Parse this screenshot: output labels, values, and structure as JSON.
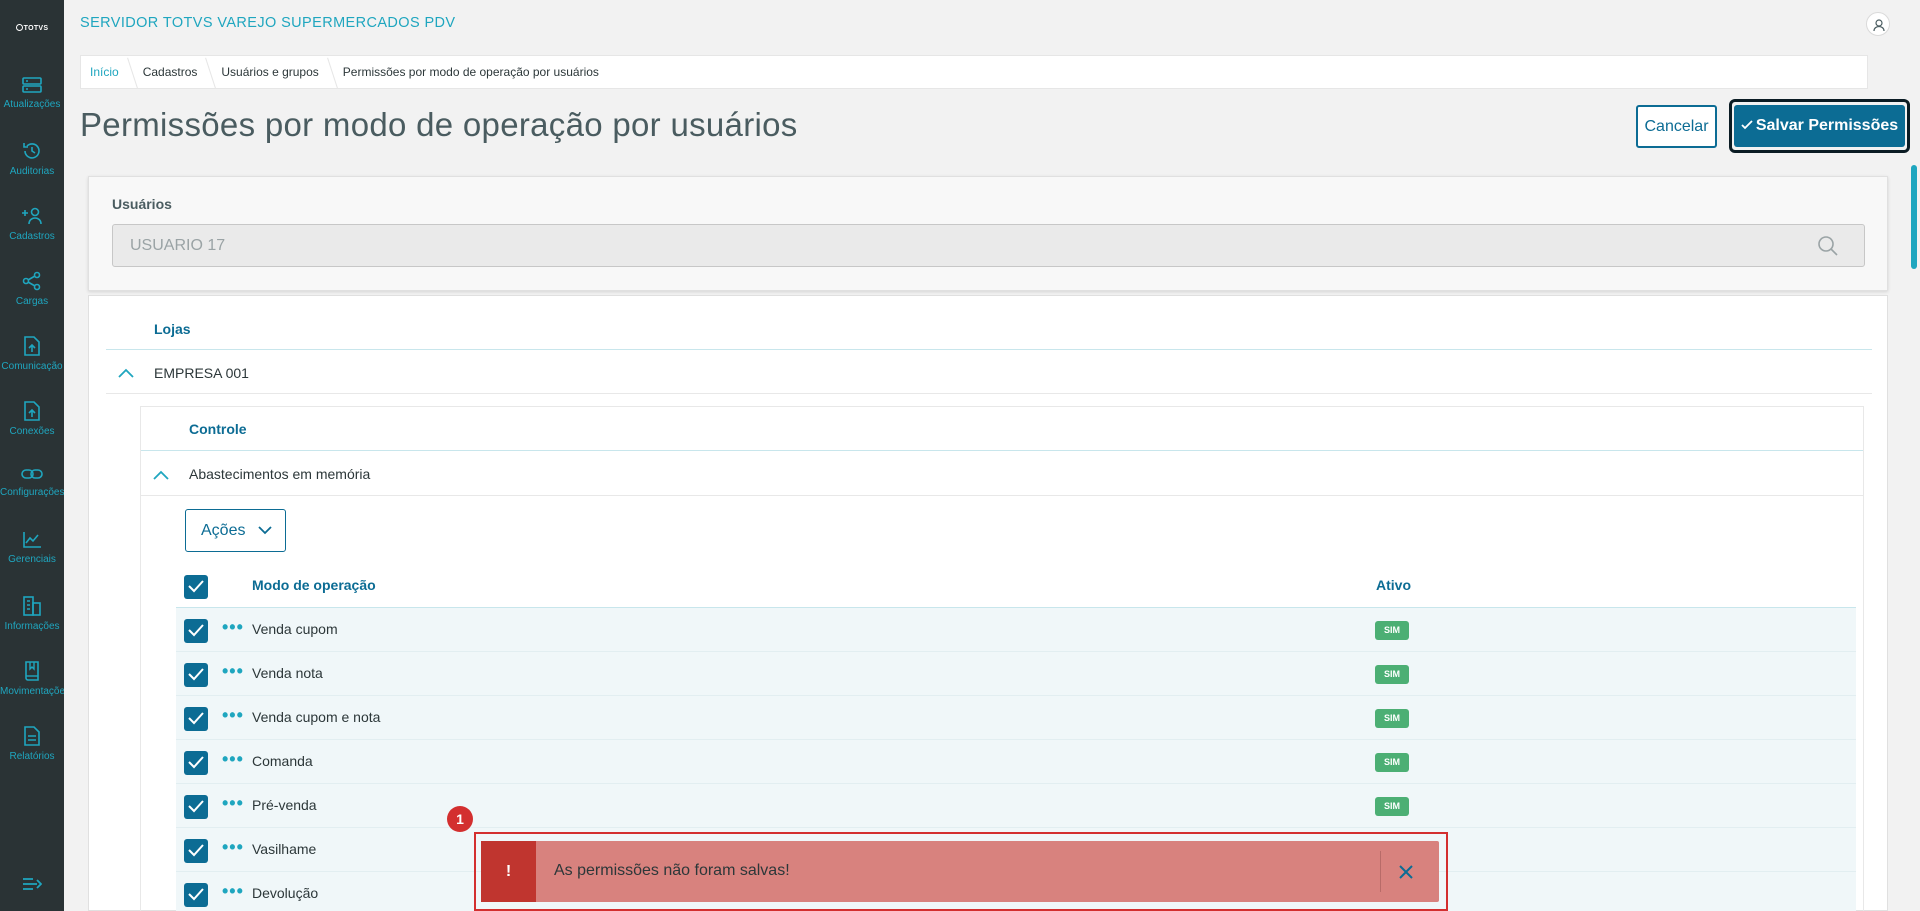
{
  "sidebar": {
    "logo_text": "TOTVS",
    "items": [
      {
        "label": "Atualizações",
        "icon": "server-icon"
      },
      {
        "label": "Auditorias",
        "icon": "history-icon"
      },
      {
        "label": "Cadastros",
        "icon": "add-user-icon"
      },
      {
        "label": "Cargas",
        "icon": "share-icon"
      },
      {
        "label": "Comunicação",
        "icon": "upload-file-icon"
      },
      {
        "label": "Conexões",
        "icon": "upload-file-icon"
      },
      {
        "label": "Configurações",
        "icon": "link-icon"
      },
      {
        "label": "Gerenciais",
        "icon": "chart-icon"
      },
      {
        "label": "Informações",
        "icon": "building-icon"
      },
      {
        "label": "Movimentações",
        "icon": "book-icon"
      },
      {
        "label": "Relatórios",
        "icon": "document-icon"
      }
    ]
  },
  "header": {
    "app_title": "SERVIDOR TOTVS VAREJO SUPERMERCADOS PDV"
  },
  "breadcrumb": [
    "Início",
    "Cadastros",
    "Usuários e grupos",
    "Permissões por modo de operação por usuários"
  ],
  "page": {
    "title": "Permissões por modo de operação por usuários",
    "cancel_label": "Cancelar",
    "save_label": "Salvar Permissões"
  },
  "users": {
    "label": "Usuários",
    "value": "USUARIO 17"
  },
  "stores": {
    "header": "Lojas",
    "company": "EMPRESA 001",
    "control_header": "Controle",
    "control_item": "Abastecimentos em memória",
    "actions_label": "Ações"
  },
  "table": {
    "col_mode": "Modo de operação",
    "col_active": "Ativo",
    "rows": [
      {
        "mode": "Venda cupom",
        "active": "SIM"
      },
      {
        "mode": "Venda nota",
        "active": "SIM"
      },
      {
        "mode": "Venda cupom e nota",
        "active": "SIM"
      },
      {
        "mode": "Comanda",
        "active": "SIM"
      },
      {
        "mode": "Pré-venda",
        "active": "SIM"
      },
      {
        "mode": "Vasilhame",
        "active": ""
      },
      {
        "mode": "Devolução",
        "active": ""
      }
    ]
  },
  "toast": {
    "icon": "!",
    "message": "As permissões não foram salvas!",
    "marker": "1"
  },
  "colors": {
    "primary": "#0c6c94",
    "accent": "#1fa6bf",
    "success": "#4caf74",
    "error": "#c0352f"
  }
}
